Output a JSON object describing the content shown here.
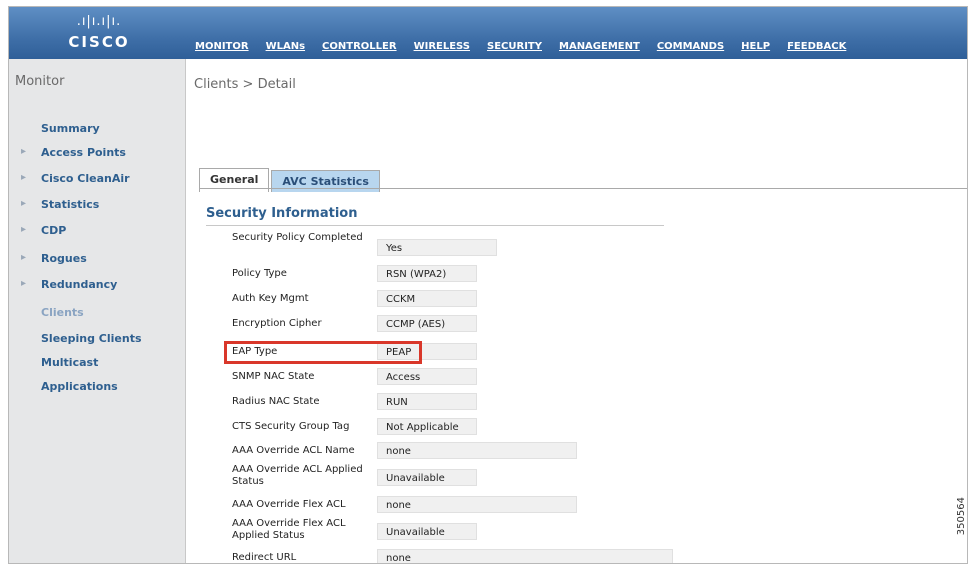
{
  "brand": {
    "name": "CISCO",
    "bars": ".ı|ı.ı|ı."
  },
  "menu": [
    "MONITOR",
    "WLANs",
    "CONTROLLER",
    "WIRELESS",
    "SECURITY",
    "MANAGEMENT",
    "COMMANDS",
    "HELP",
    "FEEDBACK"
  ],
  "sidebar": {
    "title": "Monitor",
    "items": [
      {
        "label": "Summary"
      },
      {
        "label": "Access Points"
      },
      {
        "label": "Cisco CleanAir"
      },
      {
        "label": "Statistics"
      },
      {
        "label": "CDP"
      },
      {
        "label": "Rogues"
      },
      {
        "label": "Redundancy"
      },
      {
        "label": "Clients"
      },
      {
        "label": "Sleeping Clients"
      },
      {
        "label": "Multicast"
      },
      {
        "label": "Applications"
      }
    ]
  },
  "breadcrumb": "Clients > Detail",
  "tabs": {
    "general": "General",
    "avc": "AVC Statistics"
  },
  "section": {
    "title": "Security Information"
  },
  "rows": [
    {
      "label": "Security Policy Completed",
      "value": "Yes"
    },
    {
      "label": "Policy Type",
      "value": "RSN (WPA2)"
    },
    {
      "label": "Auth Key Mgmt",
      "value": "CCKM"
    },
    {
      "label": "Encryption Cipher",
      "value": "CCMP (AES)"
    },
    {
      "label": "EAP Type",
      "value": "PEAP"
    },
    {
      "label": "SNMP NAC State",
      "value": "Access"
    },
    {
      "label": "Radius NAC State",
      "value": "RUN"
    },
    {
      "label": "CTS Security Group Tag",
      "value": "Not Applicable"
    },
    {
      "label": "AAA Override ACL Name",
      "value": "none"
    },
    {
      "label": "AAA Override ACL Applied Status",
      "value": "Unavailable"
    },
    {
      "label": "AAA Override Flex ACL",
      "value": "none"
    },
    {
      "label": "AAA Override Flex ACL Applied Status",
      "value": "Unavailable"
    },
    {
      "label": "Redirect URL",
      "value": "none"
    }
  ],
  "watermark": "350564",
  "colors": {
    "header": "#3f6fa8",
    "link": "#2e5f8f",
    "highlight": "#d9372a",
    "activeTab": "#b8d6ef"
  }
}
